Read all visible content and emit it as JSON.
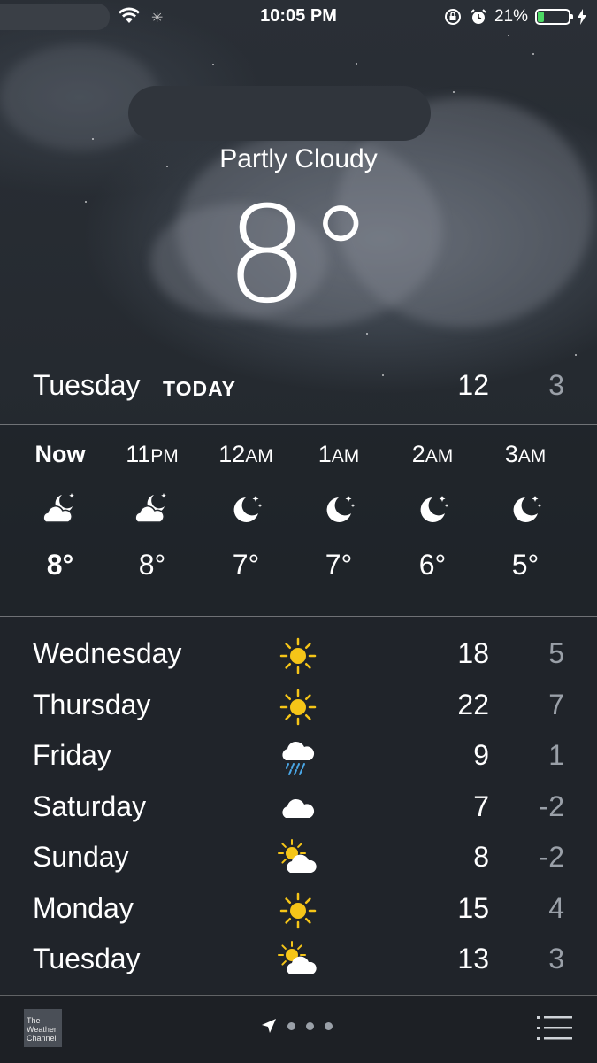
{
  "status_bar": {
    "time": "10:05 PM",
    "battery_text": "21%",
    "battery_level": 0.21,
    "icons": [
      "wifi-icon",
      "activity-spinner-icon",
      "rotation-lock-icon",
      "alarm-icon",
      "battery-icon",
      "charging-bolt-icon"
    ]
  },
  "current": {
    "condition": "Partly Cloudy",
    "temperature": "8°"
  },
  "today": {
    "day": "Tuesday",
    "label": "TODAY",
    "high": "12",
    "low": "3"
  },
  "hourly": [
    {
      "label": "Now",
      "suffix": "",
      "icon": "partly-cloudy-night-icon",
      "temp": "8°"
    },
    {
      "label": "11",
      "suffix": "PM",
      "icon": "partly-cloudy-night-icon",
      "temp": "8°"
    },
    {
      "label": "12",
      "suffix": "AM",
      "icon": "clear-night-icon",
      "temp": "7°"
    },
    {
      "label": "1",
      "suffix": "AM",
      "icon": "clear-night-icon",
      "temp": "7°"
    },
    {
      "label": "2",
      "suffix": "AM",
      "icon": "clear-night-icon",
      "temp": "6°"
    },
    {
      "label": "3",
      "suffix": "AM",
      "icon": "clear-night-icon",
      "temp": "5°"
    }
  ],
  "daily": [
    {
      "day": "Wednesday",
      "icon": "sun-icon",
      "high": "18",
      "low": "5"
    },
    {
      "day": "Thursday",
      "icon": "sun-icon",
      "high": "22",
      "low": "7"
    },
    {
      "day": "Friday",
      "icon": "rain-icon",
      "high": "9",
      "low": "1"
    },
    {
      "day": "Saturday",
      "icon": "cloud-icon",
      "high": "7",
      "low": "-2"
    },
    {
      "day": "Sunday",
      "icon": "partly-sunny-icon",
      "high": "8",
      "low": "-2"
    },
    {
      "day": "Monday",
      "icon": "sun-icon",
      "high": "15",
      "low": "4"
    },
    {
      "day": "Tuesday",
      "icon": "partly-sunny-icon",
      "high": "13",
      "low": "3"
    }
  ],
  "toolbar": {
    "logo_text": "The Weather Channel",
    "page_count": 3
  },
  "colors": {
    "sun": "#f5c518",
    "rain": "#4aa8e8",
    "battery_fill": "#4cd964",
    "secondary_text": "#9aa0a8"
  }
}
